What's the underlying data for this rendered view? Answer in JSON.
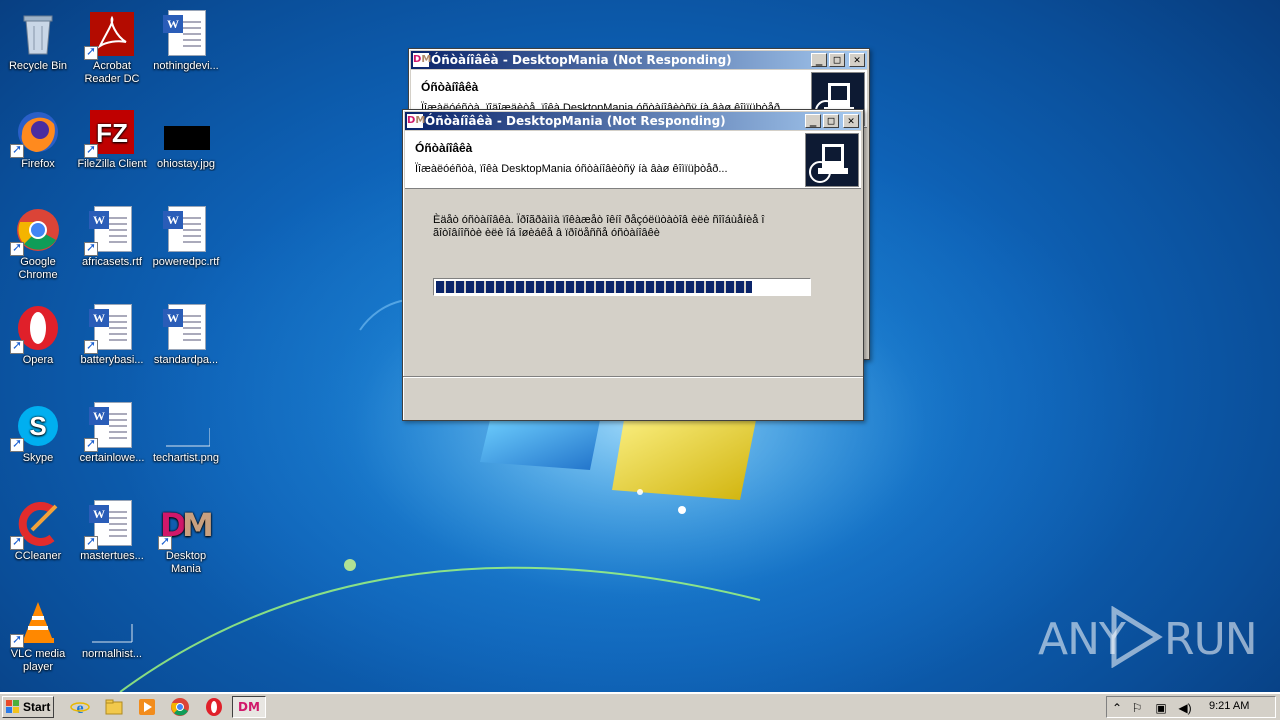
{
  "desktop": {
    "icons": [
      {
        "label": "Recycle Bin",
        "icon": "recycle-bin-icon"
      },
      {
        "label": "Acrobat Reader DC",
        "icon": "acrobat-icon"
      },
      {
        "label": "nothingdevi...",
        "icon": "word-doc-icon"
      },
      {
        "label": "Firefox",
        "icon": "firefox-icon"
      },
      {
        "label": "FileZilla Client",
        "icon": "filezilla-icon"
      },
      {
        "label": "ohiostay.jpg",
        "icon": "image-file-icon"
      },
      {
        "label": "Google Chrome",
        "icon": "chrome-icon"
      },
      {
        "label": "africasets.rtf",
        "icon": "word-doc-icon"
      },
      {
        "label": "poweredpc.rtf",
        "icon": "word-doc-icon"
      },
      {
        "label": "Opera",
        "icon": "opera-icon"
      },
      {
        "label": "batterybasi...",
        "icon": "word-doc-icon"
      },
      {
        "label": "standardpa...",
        "icon": "word-doc-icon"
      },
      {
        "label": "Skype",
        "icon": "skype-icon"
      },
      {
        "label": "certainlowe...",
        "icon": "word-doc-icon"
      },
      {
        "label": "techartist.png",
        "icon": "image-file-icon"
      },
      {
        "label": "CCleaner",
        "icon": "ccleaner-icon"
      },
      {
        "label": "mastertues...",
        "icon": "word-doc-icon"
      },
      {
        "label": "Desktop Mania",
        "icon": "desktop-mania-icon"
      },
      {
        "label": "VLC media player",
        "icon": "vlc-icon"
      },
      {
        "label": "normalhist...",
        "icon": "image-file-icon"
      }
    ],
    "watermark": {
      "left": "ANY",
      "right": "RUN"
    }
  },
  "window_back": {
    "title": "Óñòàíîâêà - DesktopMania (Not Responding)",
    "header_title": "Óñòàíîâêà",
    "header_sub": "Ïîæàëóéñòà, ïîäîæäèòå, ïîêà DesktopMania óñòàíîâèòñÿ íà âàø êîìïüþòåð..."
  },
  "window_front": {
    "title": "Óñòàíîâêà - DesktopMania (Not Responding)",
    "header_title": "Óñòàíîâêà",
    "header_sub": "Ïîæàëóéñòà, ïîêà DesktopMania óñòàíîâèòñÿ íà âàø êîìïüþòåð...",
    "body_line1": "Èäåò óñòàíîâêà. Ïðîãðàììà ïîêàæåò îêíî ðåçóëüòàòîâ èëè ñîîáùåíèå î",
    "body_line2": "ãîòîâíîñòè èëè îá îøèáêå â ïðîöåññå óñòàíîâêè",
    "progress": 0.85
  },
  "taskbar": {
    "start_label": "Start",
    "quick_launch": [
      "ie-icon",
      "explorer-icon",
      "media-player-icon",
      "chrome-icon",
      "opera-icon"
    ],
    "task_label": "DM",
    "clock": "9:21 AM"
  },
  "colors": {
    "titlebar_start": "#0a246a",
    "titlebar_end": "#a6caf0",
    "window_face": "#d4d0c8",
    "desktop_mania_pink": "#d0186a"
  }
}
